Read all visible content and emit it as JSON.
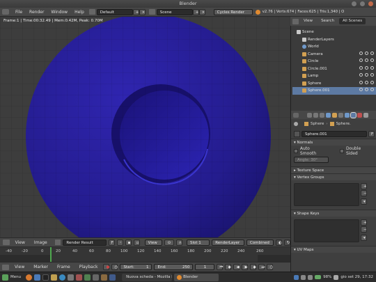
{
  "window": {
    "title": "Blender"
  },
  "menu": {
    "items": [
      "File",
      "Render",
      "Window",
      "Help"
    ],
    "screen_layout": "Default",
    "scene": "Scene",
    "render_engine": "Cycles Render",
    "stats": "v2.76 | Verts:674 | Faces:625 | Tris:1,340 | O"
  },
  "viewport": {
    "info": "Frame:1 | Time:00:32.49 | Mem:0.42M, Peak: 0.70M",
    "colors": {
      "object": "#2a20a0",
      "background": "#3d3d3d"
    }
  },
  "outliner": {
    "view_tab": "View",
    "search_tab": "Search",
    "all_scenes": "All Scenes",
    "items": [
      {
        "label": "Scene",
        "icon": "scene-icon",
        "color": "#c8c8c8"
      },
      {
        "label": "RenderLayers",
        "icon": "render-layers-icon",
        "color": "#c8c8c8"
      },
      {
        "label": "World",
        "icon": "world-icon",
        "color": "#6f98c9"
      },
      {
        "label": "Camera",
        "icon": "camera-icon",
        "color": "#d2a052"
      },
      {
        "label": "Circle",
        "icon": "mesh-icon",
        "color": "#d2a052"
      },
      {
        "label": "Circle.001",
        "icon": "mesh-icon",
        "color": "#d2a052"
      },
      {
        "label": "Lamp",
        "icon": "lamp-icon",
        "color": "#d2a052"
      },
      {
        "label": "Sphere",
        "icon": "mesh-icon",
        "color": "#d2a052"
      },
      {
        "label": "Sphere.001",
        "icon": "mesh-icon",
        "color": "#d2a052",
        "selected": true
      }
    ]
  },
  "properties": {
    "breadcrumb": [
      "Sphere",
      "Sphere."
    ],
    "mesh_name": "Sphere.001",
    "fake_user": "F",
    "normals_label": "Normals",
    "auto_smooth": "Auto Smooth",
    "double_sided": "Double Sided",
    "angle": "Angle:  30°",
    "texture_space": "Texture Space",
    "vertex_groups": "Vertex Groups",
    "shape_keys": "Shape Keys",
    "uv_maps": "UV Maps"
  },
  "image_editor": {
    "view": "View",
    "image": "Image",
    "image_name": "Render Result",
    "fake_user": "F",
    "view_menu": "View",
    "slot": "Slot 1",
    "layer": "RenderLayer",
    "pass": "Combined"
  },
  "timeline": {
    "ticks": [
      "-40",
      "-20",
      "0",
      "20",
      "40",
      "60",
      "80",
      "100",
      "120",
      "140",
      "160",
      "180",
      "200",
      "220",
      "240",
      "260"
    ],
    "view": "View",
    "marker": "Marker",
    "frame": "Frame",
    "playback": "Playback",
    "start_label": "Start:",
    "start": "1",
    "end_label": "End:",
    "end": "250",
    "current": "1"
  },
  "taskbar": {
    "menu": "Menu",
    "tasks": [
      "Nuova scheda - Mozilla F",
      "Blender"
    ],
    "battery": "98%",
    "clock": "gio set 29, 17:32"
  }
}
